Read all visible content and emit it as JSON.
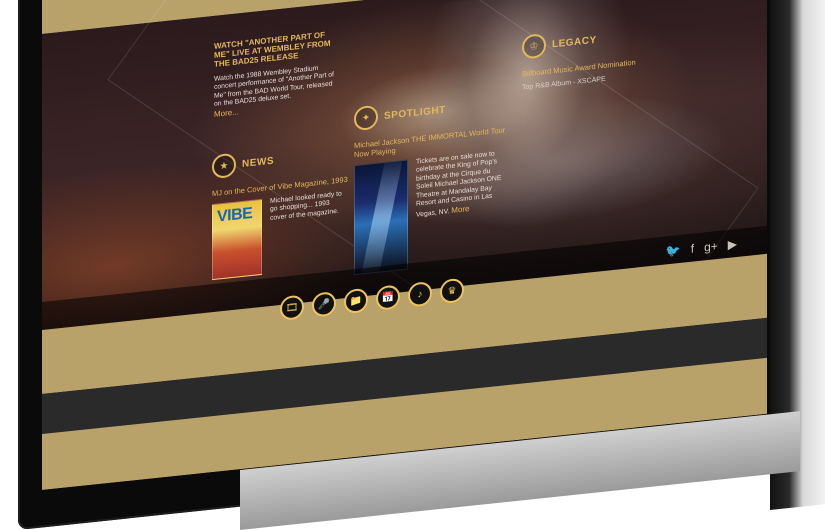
{
  "watch": {
    "headline": "WATCH \"ANOTHER PART OF ME\" LIVE AT WEMBLEY FROM THE BAD25 RELEASE",
    "body": "Watch the 1988 Wembley Stadium concert performance of \"Another Part of Me\" from the BAD World Tour, released on the BAD25 deluxe set.",
    "more": "More..."
  },
  "news": {
    "label": "NEWS",
    "headline": "MJ on the Cover of Vibe Magazine, 1993",
    "blurb": "Michael looked ready to go shopping... 1993 cover of the magazine.",
    "magazine_title": "VIBE"
  },
  "spotlight": {
    "label": "SPOTLIGHT",
    "headline": "Michael Jackson THE IMMORTAL World Tour Now Playing",
    "blurb": "Tickets are on sale now to celebrate the King of Pop's birthday at the Cirque du Soleil Michael Jackson ONE Theatre at Mandalay Bay Resort and Casino in Las Vegas, NV.",
    "more": "More"
  },
  "legacy": {
    "label": "LEGACY",
    "item1": "Billboard Music Award Nomination",
    "item2": "Top R&B Album - XSCAPE"
  },
  "social": {
    "twitter": "twitter-icon",
    "facebook": "facebook-icon",
    "googleplus": "google-plus-icon",
    "youtube": "youtube-icon"
  },
  "nav_icons": [
    {
      "icon": "film-icon"
    },
    {
      "icon": "microphone-icon"
    },
    {
      "icon": "folder-icon"
    },
    {
      "icon": "calendar-icon"
    },
    {
      "icon": "music-note-icon"
    },
    {
      "icon": "crown-icon"
    }
  ],
  "colors": {
    "gold": "#b9a16a",
    "accent": "#e2b85a"
  }
}
